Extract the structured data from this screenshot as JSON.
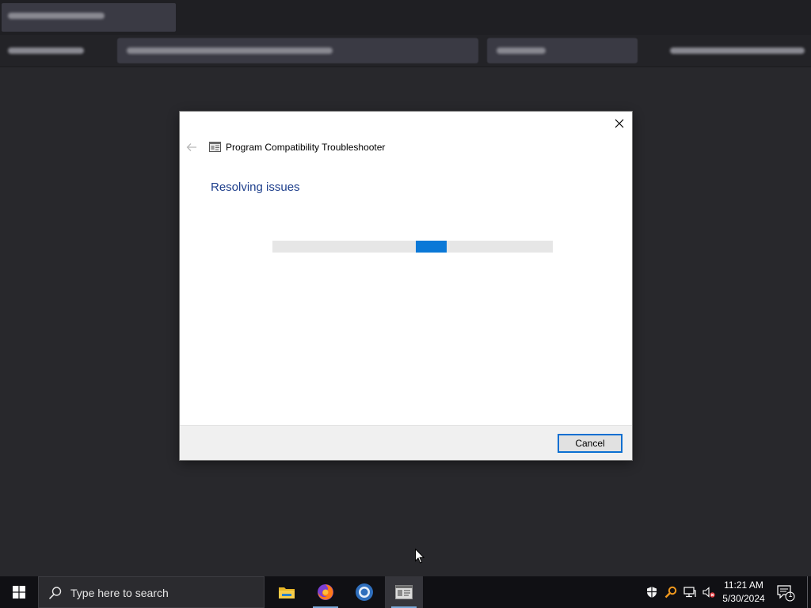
{
  "dialog": {
    "title": "Program Compatibility Troubleshooter",
    "heading": "Resolving issues",
    "progress_indeterminate": true,
    "progress_block_fraction": 0.11,
    "progress_block_position": 0.51,
    "cancel_label": "Cancel",
    "accent_color": "#0a78d7",
    "heading_color": "#1e3f8c"
  },
  "taskbar": {
    "search_placeholder": "Type here to search",
    "apps": [
      {
        "icon": "file-explorer-icon",
        "running": true,
        "active": false
      },
      {
        "icon": "firefox-icon",
        "running": true,
        "active": false
      },
      {
        "icon": "chrome-icon",
        "running": false,
        "active": false
      },
      {
        "icon": "troubleshooter-icon",
        "running": true,
        "active": true
      }
    ],
    "tray_icons": [
      "security-shield-icon",
      "search-tool-icon",
      "network-icon",
      "volume-muted-icon"
    ],
    "time": "11:21 AM",
    "date": "5/30/2024",
    "notification_count": "1"
  }
}
